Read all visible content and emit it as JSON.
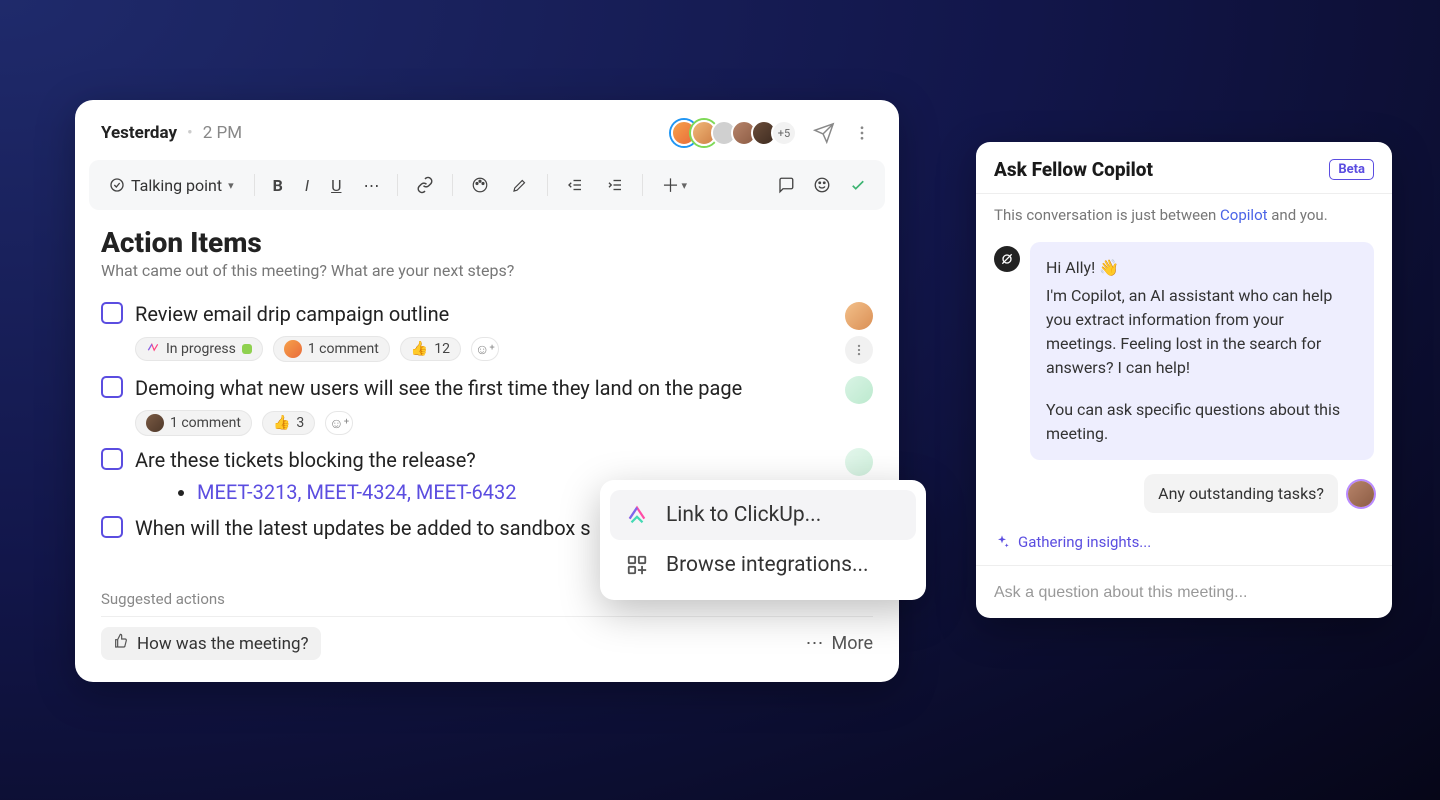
{
  "header": {
    "date": "Yesterday",
    "time": "2 PM",
    "avatar_overflow": "+5"
  },
  "toolbar": {
    "talking_point": "Talking point"
  },
  "content": {
    "title": "Action Items",
    "subtitle": "What came out of this meeting? What are your next steps?",
    "items": [
      {
        "text": "Review email drip campaign outline",
        "status_label": "In progress",
        "comments": "1 comment",
        "reaction_count": "12"
      },
      {
        "text": "Demoing what new users will see the first time they land on the page",
        "comments": "1 comment",
        "reaction_count": "3"
      },
      {
        "text": "Are these tickets blocking the release?",
        "sub_link": "MEET-3213, MEET-4324, MEET-6432"
      },
      {
        "text": "When will the latest updates be added to sandbox s"
      }
    ]
  },
  "context_menu": {
    "link_clickup": "Link to ClickUp...",
    "browse_integrations": "Browse integrations..."
  },
  "footer": {
    "suggested_label": "Suggested actions",
    "how_was_meeting": "How was the meeting?",
    "more": "More"
  },
  "copilot": {
    "title": "Ask Fellow Copilot",
    "beta": "Beta",
    "note_prefix": "This conversation is just between ",
    "note_link": "Copilot",
    "note_suffix": " and you.",
    "greeting": "Hi Ally! 👋",
    "intro1": "I'm Copilot, an AI assistant who can help you extract information from your meetings. Feeling lost in the search for answers? I can help!",
    "intro2": "You can ask specific questions about this meeting.",
    "user_msg": "Any outstanding tasks?",
    "gathering": "Gathering insights...",
    "placeholder": "Ask a question about this meeting..."
  }
}
